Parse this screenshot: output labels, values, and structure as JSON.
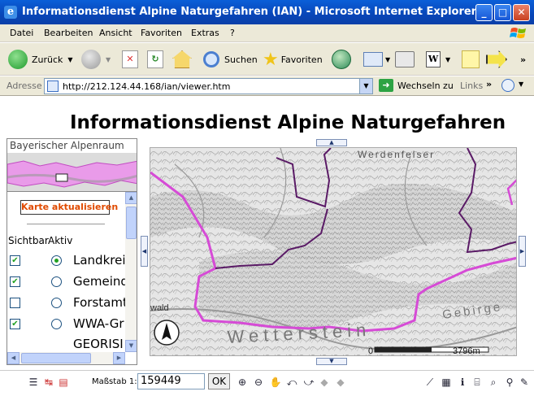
{
  "window": {
    "title": "Informationsdienst Alpine Naturgefahren (IAN) - Microsoft Internet Explorer",
    "minimize": "_",
    "maximize": "□",
    "close": "✕",
    "app_icon": "e"
  },
  "menu": {
    "items": [
      "Datei",
      "Bearbeiten",
      "Ansicht",
      "Favoriten",
      "Extras",
      "?"
    ]
  },
  "toolbar": {
    "back_label": "Zurück",
    "search_label": "Suchen",
    "favorites_label": "Favoriten"
  },
  "address": {
    "label": "Adresse",
    "url": "http://212.124.44.168/ian/viewer.htm",
    "go_label": "Wechseln zu",
    "links_label": "Links"
  },
  "page": {
    "title": "Informationsdienst Alpine Naturgefahren"
  },
  "overview": {
    "caption": "Bayerischer Alpenraum"
  },
  "layers": {
    "refresh_label": "Karte aktualisieren",
    "col_visible": "Sichtbar",
    "col_active": "Aktiv",
    "items": [
      {
        "name": "Landkrei",
        "visible": true,
        "active": true
      },
      {
        "name": "Gemeind",
        "visible": true,
        "active": false
      },
      {
        "name": "Forstamt",
        "visible": false,
        "active": false
      },
      {
        "name": "WWA-Gr",
        "visible": true,
        "active": false
      },
      {
        "name": "GEORISI",
        "visible": false,
        "active": false
      }
    ]
  },
  "map": {
    "labels": {
      "place_top": "Werdenfelser",
      "place_left": "wald",
      "area_bottom": "Wetterstein",
      "ridge_right": "Gebirge",
      "north": "N"
    },
    "scale_zero": "0",
    "scale_length": "3796m"
  },
  "status": {
    "scale_label": "Maßstab 1:",
    "scale_value": "159449",
    "ok_label": "OK"
  },
  "colors": {
    "title_bar": "#0846b8",
    "chrome": "#ece9d8",
    "border_line": "#d64bd6",
    "admin_line": "#5a1a66",
    "refresh_text": "#e04a00"
  }
}
